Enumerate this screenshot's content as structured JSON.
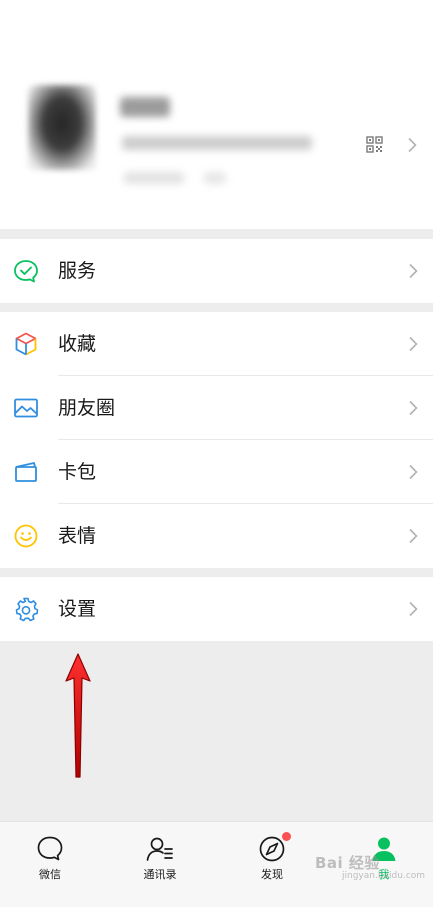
{
  "menu": {
    "services": "服务",
    "favorites": "收藏",
    "moments": "朋友圈",
    "cards": "卡包",
    "stickers": "表情",
    "settings": "设置"
  },
  "tabbar": {
    "chats": "微信",
    "contacts": "通讯录",
    "discover": "发现",
    "me": "我"
  },
  "watermark": {
    "text": "Bai 经验",
    "sub": "jingyan.baidu.com"
  },
  "colors": {
    "wechat_green": "#07c160",
    "annotation_arrow": "#e01f1f",
    "badge": "#fa5151"
  },
  "icons": {
    "services": "check-bubble-icon",
    "favorites": "cube-icon",
    "moments": "picture-icon",
    "cards": "wallet-icon",
    "stickers": "smile-icon",
    "settings": "gear-icon"
  }
}
